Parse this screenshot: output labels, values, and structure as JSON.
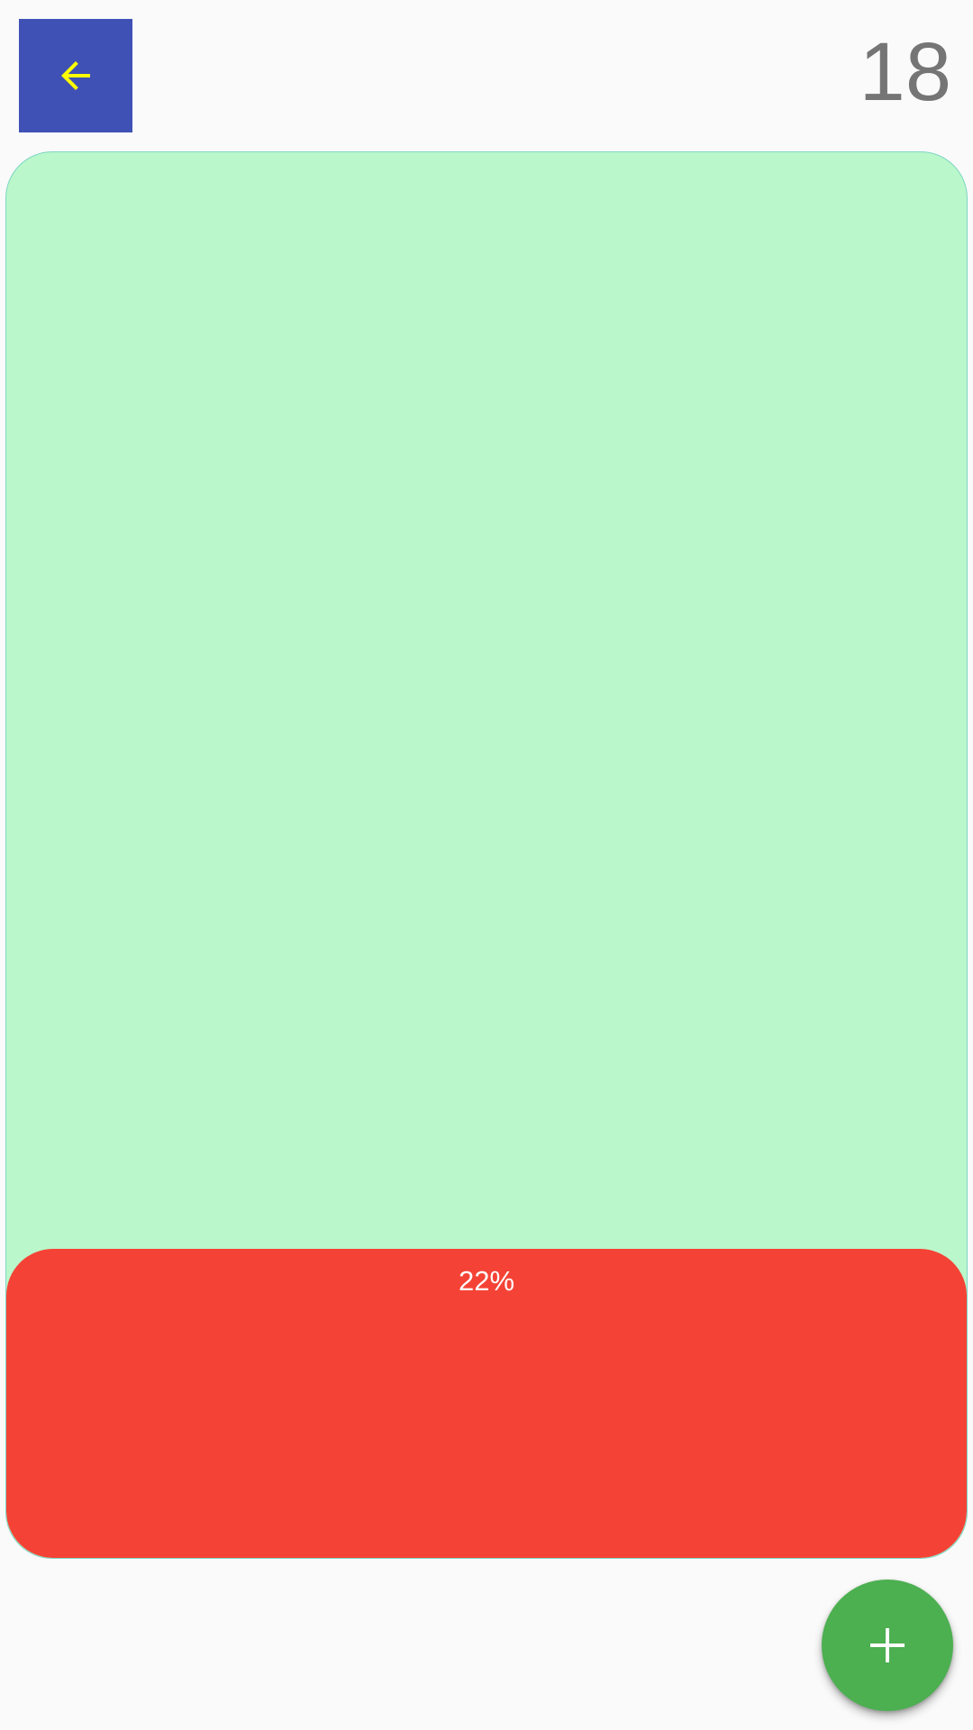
{
  "header": {
    "back_icon": "arrow-left-icon",
    "counter": "18"
  },
  "progress": {
    "label": "22%",
    "value": 22
  },
  "fab": {
    "icon": "plus-icon"
  },
  "colors": {
    "back_button_bg": "#3f51b5",
    "back_icon": "#ffff00",
    "container_bg": "#baf7cb",
    "container_border": "#7fd6c4",
    "fill": "#f44336",
    "fab_bg": "#4caf50",
    "counter_text": "#757575"
  }
}
